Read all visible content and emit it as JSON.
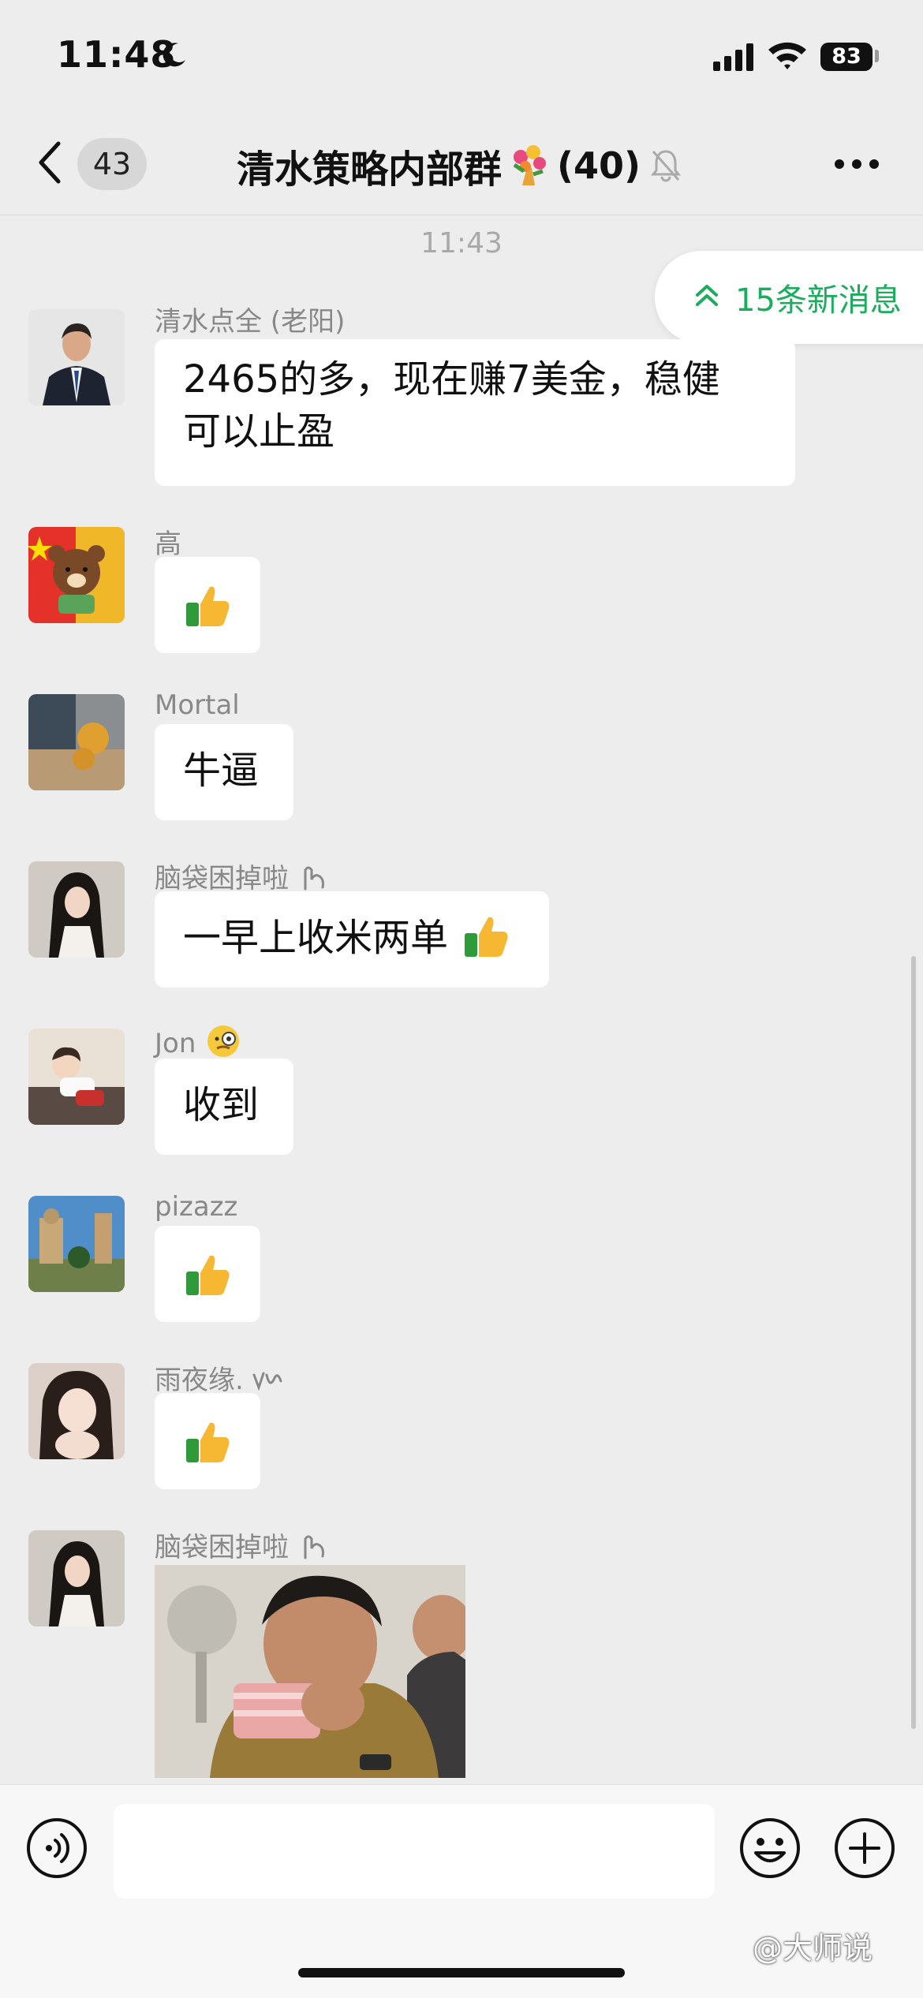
{
  "status_bar": {
    "time": "11:48",
    "battery": "83"
  },
  "nav": {
    "back_count": "43",
    "title": "清水策略内部群",
    "member_count": "(40)"
  },
  "chat": {
    "timestamp": "11:43",
    "new_messages_label": "15条新消息",
    "messages": [
      {
        "sender": "清水点全 (老阳)",
        "text_line1": "2465的多，现在赚7美金，稳健",
        "text_line2": "可以止盈"
      },
      {
        "sender": "高",
        "text": "👍"
      },
      {
        "sender": "Mortal",
        "text": "牛逼"
      },
      {
        "sender": "脑袋困掉啦",
        "text": "一早上收米两单"
      },
      {
        "sender": "Jon",
        "text": "收到"
      },
      {
        "sender": "pizazz",
        "text": "👍"
      },
      {
        "sender": "雨夜缘.",
        "text": "👍"
      },
      {
        "sender": "脑袋困掉啦",
        "text": ""
      }
    ]
  },
  "input": {
    "placeholder": ""
  },
  "watermark": "@大师说",
  "colors": {
    "accent_green": "#1aad5b",
    "background": "#ededed",
    "bubble": "#ffffff"
  }
}
